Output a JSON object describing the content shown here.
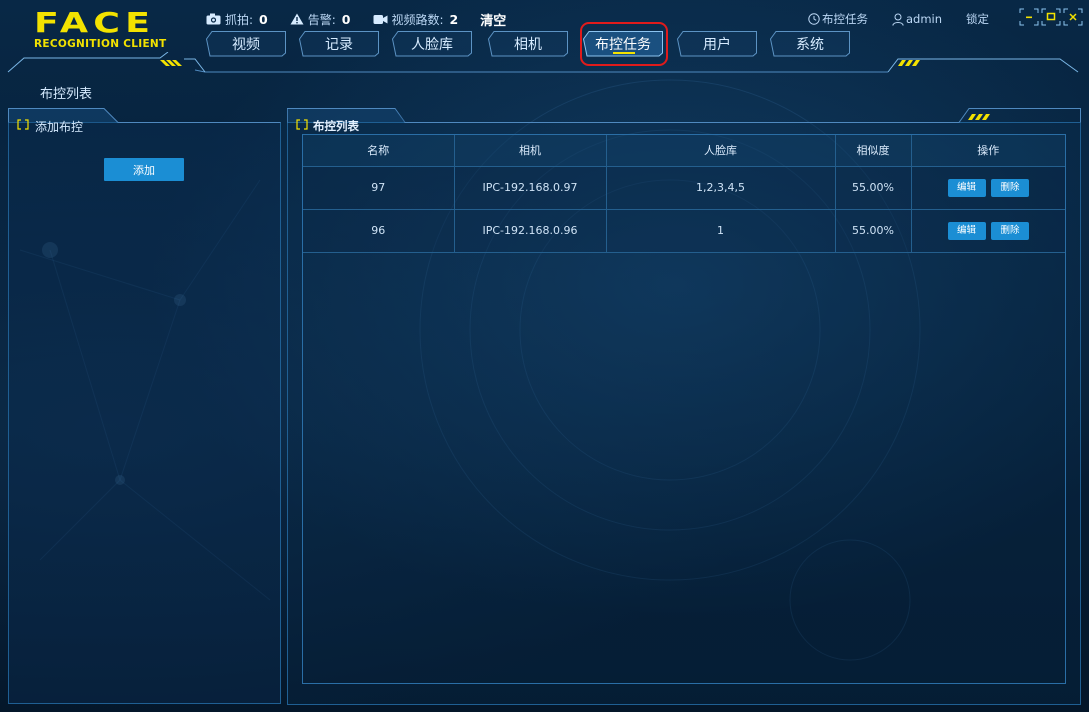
{
  "app": {
    "logo_main": "FACE",
    "logo_sub": "RECOGNITION CLIENT"
  },
  "stats": {
    "capture_label": "抓拍:",
    "capture_value": "0",
    "alarm_label": "告警:",
    "alarm_value": "0",
    "video_label": "视频路数:",
    "video_value": "2",
    "clear_label": "清空"
  },
  "tabs": [
    {
      "label": "视频"
    },
    {
      "label": "记录"
    },
    {
      "label": "人脸库"
    },
    {
      "label": "相机"
    },
    {
      "label": "布控任务",
      "active": true
    },
    {
      "label": "用户"
    },
    {
      "label": "系统"
    }
  ],
  "top_right": {
    "task_label": "布控任务",
    "user_label": "admin",
    "lock_label": "锁定"
  },
  "page": {
    "title": "布控列表"
  },
  "left_panel": {
    "title": "添加布控",
    "add_button": "添加"
  },
  "right_panel": {
    "title": "布控列表"
  },
  "table": {
    "headers": [
      "名称",
      "相机",
      "人脸库",
      "相似度",
      "操作"
    ],
    "rows": [
      {
        "name": "97",
        "camera": "IPC-192.168.0.97",
        "face_db": "1,2,3,4,5",
        "similarity": "55.00%"
      },
      {
        "name": "96",
        "camera": "IPC-192.168.0.96",
        "face_db": "1",
        "similarity": "55.00%"
      }
    ],
    "edit_label": "编辑",
    "delete_label": "删除"
  },
  "colors": {
    "accent_yellow": "#f3e200",
    "button_blue": "#1b8ed4",
    "highlight_red": "#e01b1b",
    "background": "#05192e"
  }
}
